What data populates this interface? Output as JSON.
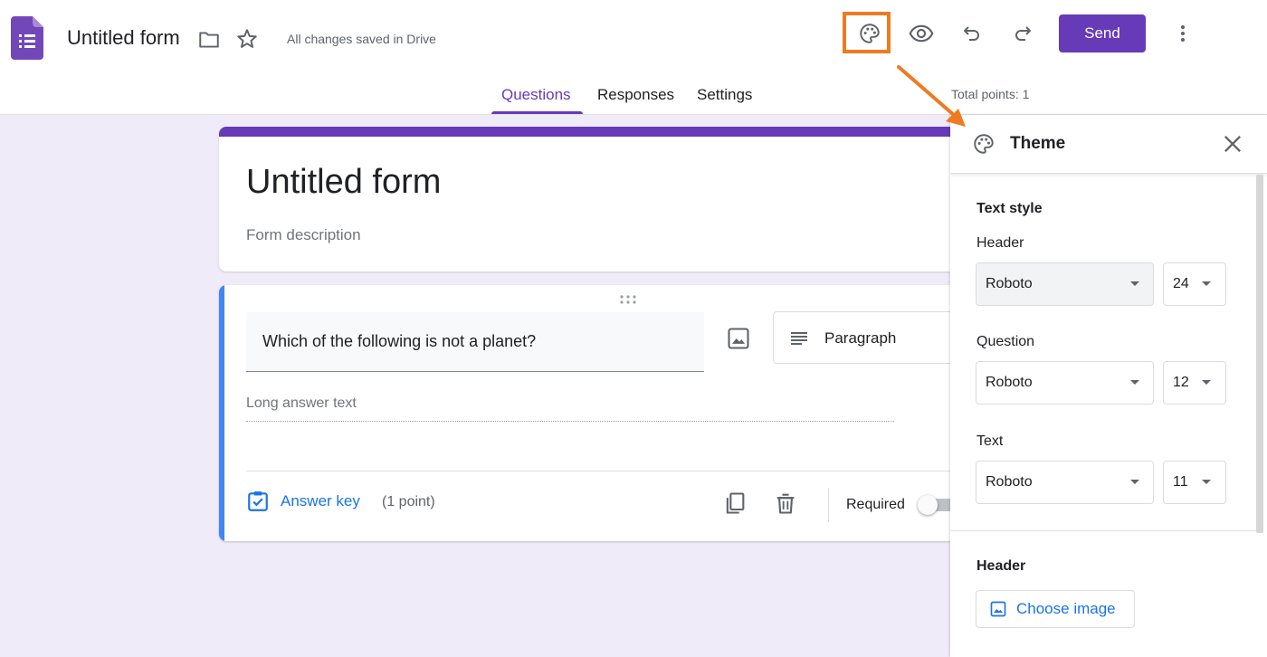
{
  "header": {
    "form_name": "Untitled form",
    "save_status": "All changes saved in Drive",
    "send_label": "Send",
    "icons": [
      "forms-app-icon",
      "folder-icon",
      "star-icon",
      "palette-icon",
      "eye-icon",
      "undo-icon",
      "redo-icon",
      "more-vert-icon"
    ]
  },
  "tabs": [
    {
      "label": "Questions",
      "active": true
    },
    {
      "label": "Responses",
      "active": false
    },
    {
      "label": "Settings",
      "active": false
    }
  ],
  "total_points": "Total points: 1",
  "title_card": {
    "title": "Untitled form",
    "description": "Form description"
  },
  "question_card": {
    "question": "Which of the following is not a planet?",
    "type": "Paragraph",
    "answer_placeholder": "Long answer text",
    "answer_key_label": "Answer key",
    "points": "(1 point)",
    "required_label": "Required",
    "required_on": false
  },
  "theme_panel": {
    "title": "Theme",
    "text_style_title": "Text style",
    "header_label": "Header",
    "header_font": "Roboto",
    "header_size": "24",
    "question_label": "Question",
    "question_font": "Roboto",
    "question_size": "12",
    "text_label": "Text",
    "text_font": "Roboto",
    "text_size": "11",
    "header_section_title": "Header",
    "choose_image_label": "Choose image"
  },
  "colors": {
    "brand_purple": "#673ab7",
    "background": "#f0ebf8",
    "highlight_orange": "#ee7b22",
    "link_blue": "#1a73e8",
    "active_card_blue": "#4285f4"
  }
}
